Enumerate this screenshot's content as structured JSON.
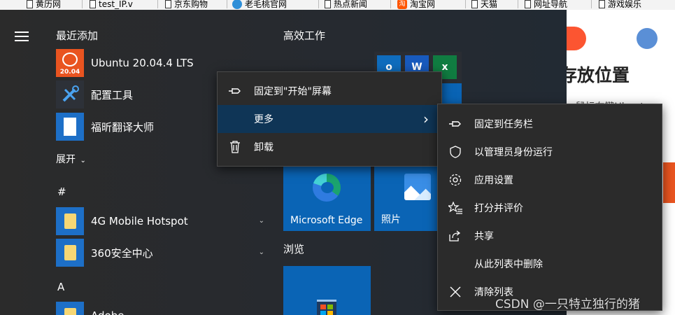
{
  "bookmarks": [
    {
      "label": "黄历网",
      "icon": "page-icon"
    },
    {
      "label": "test_IP.v",
      "icon": "page-icon"
    },
    {
      "label": "京东购物",
      "icon": "page-icon"
    },
    {
      "label": "老毛桃官网",
      "icon": "globe-icon"
    },
    {
      "label": "热点新闻",
      "icon": "page-icon"
    },
    {
      "label": "淘宝网",
      "icon": "taobao-icon",
      "icon_text": "淘"
    },
    {
      "label": "天猫",
      "icon": "page-icon"
    },
    {
      "label": "网址导航",
      "icon": "page-icon"
    },
    {
      "label": "游戏娱乐",
      "icon": "page-icon"
    }
  ],
  "start_menu": {
    "recent_header": "最近添加",
    "recent": [
      {
        "label": "Ubuntu 20.04.4 LTS",
        "icon": "ubuntu-icon",
        "icon_text": "20.04"
      },
      {
        "label": "配置工具",
        "icon": "tools-icon"
      },
      {
        "label": "福昕翻译大师",
        "icon": "document-icon"
      }
    ],
    "expand_label": "展开",
    "group_hash": "#",
    "hash_items": [
      {
        "label": "4G Mobile Hotspot",
        "icon": "folder-icon"
      },
      {
        "label": "360安全中心",
        "icon": "folder-icon"
      }
    ],
    "group_a": "A",
    "a_items": [
      {
        "label": "Adobe",
        "icon": "folder-icon"
      }
    ]
  },
  "tiles": {
    "productivity_header": "高效工作",
    "browse_header": "浏览",
    "edge_label": "Microsoft Edge",
    "photos_label": "照片",
    "office_icons": [
      {
        "icon": "outlook-icon",
        "letter": "o",
        "color": "#0f6cbd"
      },
      {
        "icon": "word-icon",
        "letter": "W",
        "color": "#185abd"
      },
      {
        "icon": "excel-icon",
        "letter": "x",
        "color": "#107c41"
      }
    ]
  },
  "context_menu": {
    "items": [
      {
        "label": "固定到\"开始\"屏幕",
        "icon": "pin-icon"
      },
      {
        "label": "更多",
        "icon": ""
      },
      {
        "label": "卸载",
        "icon": "trash-icon"
      }
    ]
  },
  "submenu": {
    "items": [
      {
        "label": "固定到任务栏",
        "icon": "pin-icon"
      },
      {
        "label": "以管理员身份运行",
        "icon": "shield-icon"
      },
      {
        "label": "应用设置",
        "icon": "gear-icon"
      },
      {
        "label": "打分并评价",
        "icon": "star-list-icon"
      },
      {
        "label": "共享",
        "icon": "share-icon"
      },
      {
        "label": "从此列表中删除",
        "icon": ""
      },
      {
        "label": "清除列表",
        "icon": "close-icon"
      }
    ]
  },
  "browser": {
    "heading": "存放位置",
    "snippet": "… 鼠标右键Ubuntu"
  },
  "watermark": "CSDN @一只特立独行的猪"
}
